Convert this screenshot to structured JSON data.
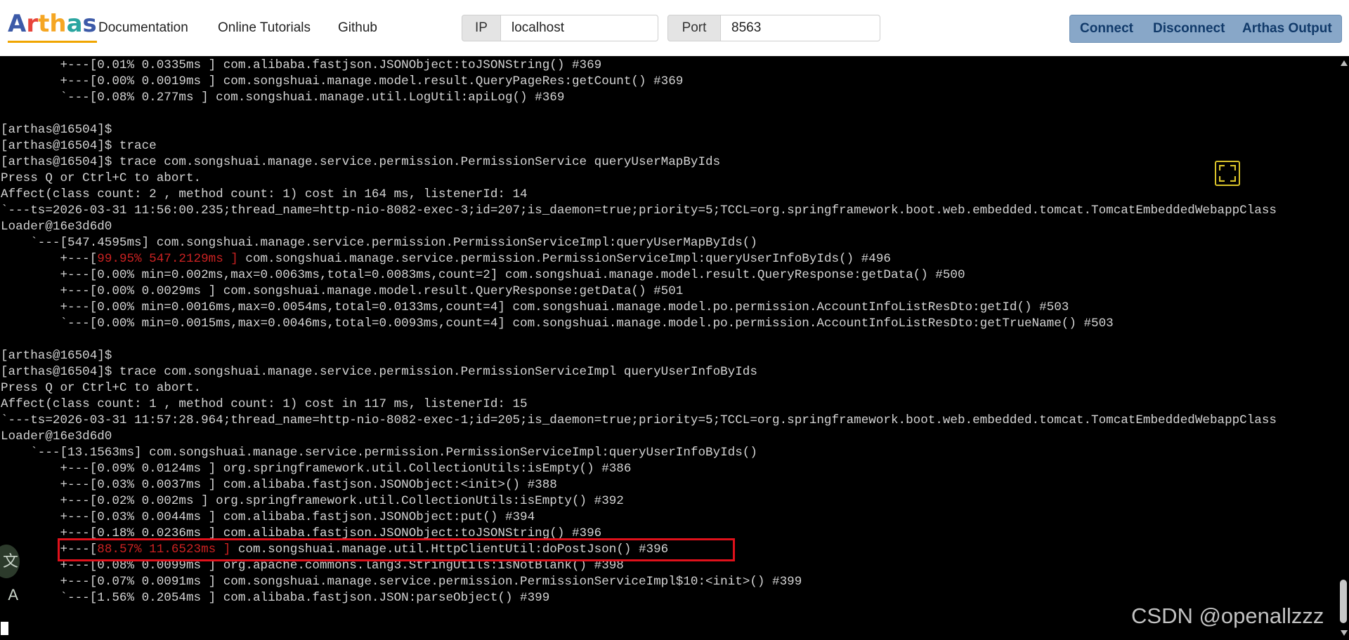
{
  "nav": {
    "logo": "Arthas",
    "logo_colors": [
      "#3c5aa8",
      "#e8443a",
      "#f5a623",
      "#f5a623",
      "#2aa5a0",
      "#3c5aa8"
    ],
    "links": [
      "Documentation",
      "Online Tutorials",
      "Github"
    ],
    "ip_label": "IP",
    "ip_value": "localhost",
    "port_label": "Port",
    "port_value": "8563",
    "connect_label": "Connect",
    "disconnect_label": "Disconnect",
    "output_label": "Arthas Output"
  },
  "terminal": {
    "lines": [
      "        +---[0.01% 0.0335ms ] com.alibaba.fastjson.JSONObject:toJSONString() #369",
      "        +---[0.00% 0.0019ms ] com.songshuai.manage.model.result.QueryPageRes:getCount() #369",
      "        `---[0.08% 0.277ms ] com.songshuai.manage.util.LogUtil:apiLog() #369",
      "",
      "[arthas@16504]$",
      "[arthas@16504]$ trace",
      "[arthas@16504]$ trace com.songshuai.manage.service.permission.PermissionService queryUserMapByIds",
      "Press Q or Ctrl+C to abort.",
      "Affect(class count: 2 , method count: 1) cost in 164 ms, listenerId: 14",
      "`---ts=2026-03-31 11:56:00.235;thread_name=http-nio-8082-exec-3;id=207;is_daemon=true;priority=5;TCCL=org.springframework.boot.web.embedded.tomcat.TomcatEmbeddedWebappClass",
      "Loader@16e3d6d0",
      "    `---[547.4595ms] com.songshuai.manage.service.permission.PermissionServiceImpl:queryUserMapByIds()",
      "        +---[99.95% 547.2129ms ] com.songshuai.manage.service.permission.PermissionServiceImpl:queryUserInfoByIds() #496",
      "        +---[0.00% min=0.002ms,max=0.0063ms,total=0.0083ms,count=2] com.songshuai.manage.model.result.QueryResponse:getData() #500",
      "        +---[0.00% 0.0029ms ] com.songshuai.manage.model.result.QueryResponse:getData() #501",
      "        +---[0.00% min=0.0016ms,max=0.0054ms,total=0.0133ms,count=4] com.songshuai.manage.model.po.permission.AccountInfoListResDto:getId() #503",
      "        `---[0.00% min=0.0015ms,max=0.0046ms,total=0.0093ms,count=4] com.songshuai.manage.model.po.permission.AccountInfoListResDto:getTrueName() #503",
      "",
      "[arthas@16504]$",
      "[arthas@16504]$ trace com.songshuai.manage.service.permission.PermissionServiceImpl queryUserInfoByIds",
      "Press Q or Ctrl+C to abort.",
      "Affect(class count: 1 , method count: 1) cost in 117 ms, listenerId: 15",
      "`---ts=2026-03-31 11:57:28.964;thread_name=http-nio-8082-exec-1;id=205;is_daemon=true;priority=5;TCCL=org.springframework.boot.web.embedded.tomcat.TomcatEmbeddedWebappClass",
      "Loader@16e3d6d0",
      "    `---[13.1563ms] com.songshuai.manage.service.permission.PermissionServiceImpl:queryUserInfoByIds()",
      "        +---[0.09% 0.0124ms ] org.springframework.util.CollectionUtils:isEmpty() #386",
      "        +---[0.03% 0.0037ms ] com.alibaba.fastjson.JSONObject:<init>() #388",
      "        +---[0.02% 0.002ms ] org.springframework.util.CollectionUtils:isEmpty() #392",
      "        +---[0.03% 0.0044ms ] com.alibaba.fastjson.JSONObject:put() #394",
      "        +---[0.18% 0.0236ms ] com.alibaba.fastjson.JSONObject:toJSONString() #396",
      "        +---[88.57% 11.6523ms ] com.songshuai.manage.util.HttpClientUtil:doPostJson() #396",
      "        +---[0.08% 0.0099ms ] org.apache.commons.lang3.StringUtils:isNotBlank() #398",
      "        +---[0.07% 0.0091ms ] com.songshuai.manage.service.permission.PermissionServiceImpl$10:<init>() #399",
      "        `---[1.56% 0.2054ms ] com.alibaba.fastjson.JSON:parseObject() #399"
    ],
    "red_segments": {
      "12": "[99.95% 547.2129ms ]",
      "30": "[88.57% 11.6523ms ]"
    }
  },
  "watermark": "CSDN @openallzzz",
  "translate_icon": "文A"
}
